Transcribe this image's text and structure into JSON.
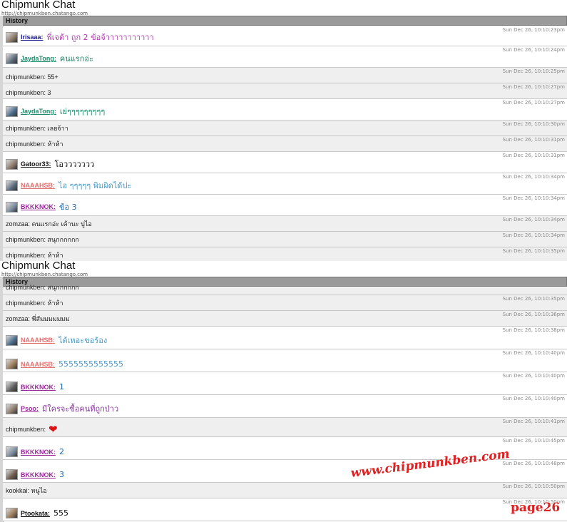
{
  "colors": {
    "history_bar": "#9a9a9a",
    "row_gray": "#efefef",
    "timestamp": "#8a8a8a",
    "watermark": "#e02020"
  },
  "panels": [
    {
      "title": "Chipmunk Chat",
      "url": "http://chipmunkben.chatango.com",
      "history_label": "History",
      "rows": [
        {
          "user": "Irisaaa:",
          "msg": "พี่เจต้า ถูก 2 ข้อจ้าาาาาาาาาาา",
          "time": "Sun Dec 26, 10:10:23pm",
          "avatar": true,
          "ucolor": "#1b1b8f",
          "mcolor": "#b03ab0"
        },
        {
          "user": "JaydaTong:",
          "msg": "คนแรกอ่ะ",
          "time": "Sun Dec 26, 10:10:24pm",
          "avatar": true,
          "ucolor": "#1a8a6a",
          "mcolor": "#1a8a6a"
        },
        {
          "plain": "chipmunkben: 55+",
          "time": "Sun Dec 26, 10:10:25pm"
        },
        {
          "plain": "chipmunkben: 3",
          "time": "Sun Dec 26, 10:10:27pm"
        },
        {
          "user": "JaydaTong:",
          "msg": "เย่ๆๆๆๆๆๆๆๆๆ",
          "time": "Sun Dec 26, 10:10:27pm",
          "avatar": true,
          "ucolor": "#1a8a6a",
          "mcolor": "#1a8a6a"
        },
        {
          "plain": "chipmunkben: เลยจ้าา",
          "time": "Sun Dec 26, 10:10:30pm"
        },
        {
          "plain": "chipmunkben: ห้าห้า",
          "time": "Sun Dec 26, 10:10:31pm"
        },
        {
          "user": "Gatoor33:",
          "msg": "โอววววววว",
          "time": "Sun Dec 26, 10:10:31pm",
          "avatar": true,
          "ucolor": "#111111",
          "mcolor": "#111111"
        },
        {
          "user": "NAAAHSB:",
          "msg": "ไอ ๆๆๆๆๆ พิมผิดได้ปะ",
          "time": "Sun Dec 26, 10:10:34pm",
          "avatar": true,
          "ucolor": "#e07070",
          "mcolor": "#4a9ac8"
        },
        {
          "user": "BKKKNOK:",
          "msg": "ข้อ 3",
          "time": "Sun Dec 26, 10:10:34pm",
          "avatar": true,
          "ucolor": "#9a2a9a",
          "mcolor": "#1a6ab0"
        },
        {
          "plain": "zomzaa: คนแรกอ่ะ เค้านะ ปูไอ",
          "time": "Sun Dec 26, 10:10:34pm"
        },
        {
          "plain": "chipmunkben: สนุกกกกกก",
          "time": "Sun Dec 26, 10:10:34pm"
        },
        {
          "plain": "chipmunkben: ห้าห้า",
          "time": "Sun Dec 26, 10:10:35pm"
        }
      ]
    },
    {
      "title": "Chipmunk Chat",
      "url": "http://chipmunkben.chatango.com",
      "history_label": "History",
      "rows": [
        {
          "plain": "chipmunkben: สนุกกกกกก",
          "time": ""
        },
        {
          "plain": "chipmunkben: ห้าห้า",
          "time": "Sun Dec 26, 10:10:35pm"
        },
        {
          "plain": "zomzaa: พี่สัมมมมมมม",
          "time": "Sun Dec 26, 10:10:36pm"
        },
        {
          "user": "NAAAHSB:",
          "msg": "ได้เหอะขอร้อง",
          "time": "Sun Dec 26, 10:10:38pm",
          "avatar": true,
          "ucolor": "#e07070",
          "mcolor": "#4a9ac8"
        },
        {
          "user": "NAAAHSB:",
          "msg": "5555555555555",
          "time": "Sun Dec 26, 10:10:40pm",
          "avatar": true,
          "ucolor": "#e07070",
          "mcolor": "#4a9ac8"
        },
        {
          "user": "BKKKNOK:",
          "msg": "1",
          "time": "Sun Dec 26, 10:10:40pm",
          "avatar": true,
          "ucolor": "#9a2a9a",
          "mcolor": "#1a6ab0"
        },
        {
          "user": "Psoo:",
          "msg": "มีใครจะซื้อคนที่ถูกป่าว",
          "time": "Sun Dec 26, 10:10:40pm",
          "avatar": true,
          "ucolor": "#9a2a9a",
          "mcolor": "#8a3aa0"
        },
        {
          "plain": "chipmunkben:",
          "heart": true,
          "time": "Sun Dec 26, 10:10:41pm"
        },
        {
          "user": "BKKKNOK:",
          "msg": "2",
          "time": "Sun Dec 26, 10:10:45pm",
          "avatar": true,
          "ucolor": "#9a2a9a",
          "mcolor": "#1a6ab0"
        },
        {
          "user": "BKKKNOK:",
          "msg": "3",
          "time": "Sun Dec 26, 10:10:48pm",
          "avatar": true,
          "ucolor": "#9a2a9a",
          "mcolor": "#1a6ab0"
        },
        {
          "plain": "kookkai: หนูไอ",
          "time": "Sun Dec 26, 10:10:50pm"
        },
        {
          "user": "Ptookata:",
          "msg": "555",
          "time": "Sun Dec 26, 10:10:50pm",
          "avatar": true,
          "ucolor": "#111111",
          "mcolor": "#111111"
        }
      ]
    }
  ],
  "watermark": "www.chipmunkben.com",
  "page_label": "page26"
}
